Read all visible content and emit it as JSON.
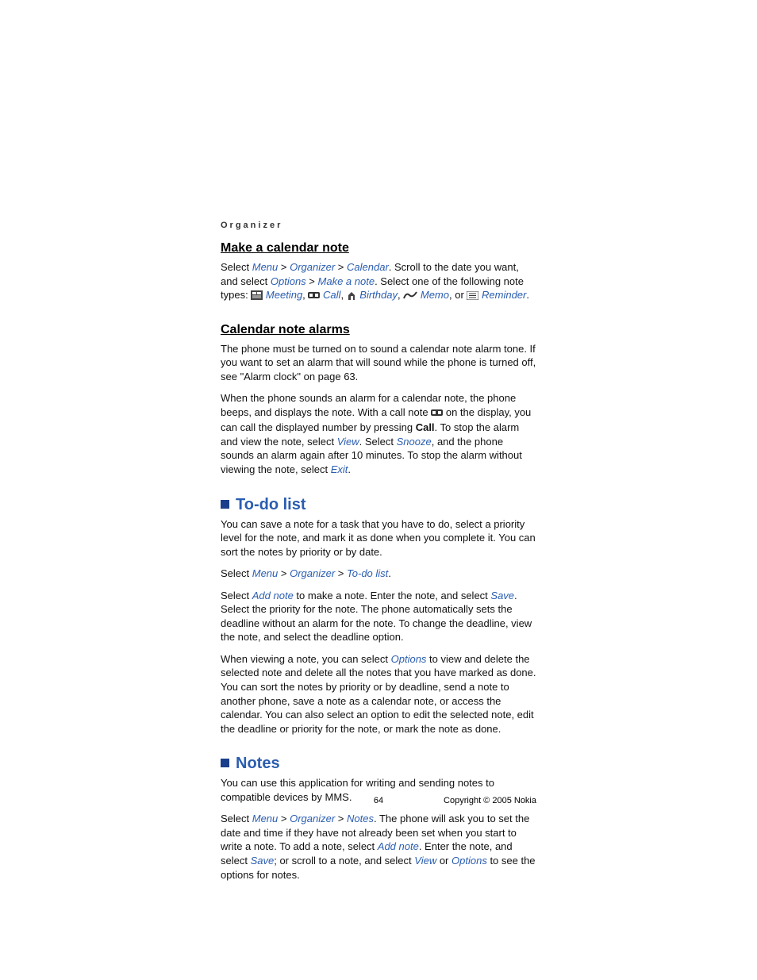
{
  "breadcrumb": "Organizer",
  "sec1": {
    "title": "Make a calendar note",
    "p1_a": "Select ",
    "menu": "Menu",
    "organizer": "Organizer",
    "calendar": "Calendar",
    "p1_b": ". Scroll to the date you want, and select ",
    "options": "Options",
    "makenote": "Make a note",
    "p1_c": ". Select one of the following note types: ",
    "meeting": "Meeting",
    "call": "Call",
    "birthday": "Birthday",
    "memo": "Memo",
    "or": ", or ",
    "reminder": "Reminder",
    "period": "."
  },
  "sec2": {
    "title": "Calendar note alarms",
    "p1": "The phone must be turned on to sound a calendar note alarm tone. If you want to set an alarm that will sound while the phone is turned off, see \"Alarm clock\" on page 63.",
    "p2_a": "When the phone sounds an alarm for a calendar note, the phone beeps, and displays the note. With a call note ",
    "p2_b": " on the display, you can call the displayed number by pressing ",
    "call_key": "Call",
    "p2_c": ". To stop the alarm and view the note, select ",
    "view": "View",
    "p2_d": ". Select ",
    "snooze": "Snooze",
    "p2_e": ", and the phone sounds an alarm again after 10 minutes. To stop the alarm without viewing the note, select ",
    "exit": "Exit",
    "period": "."
  },
  "sec3": {
    "title": "To-do list",
    "p1": "You can save a note for a task that you have to do, select a priority level for the note, and mark it as done when you complete it. You can sort the notes by priority or by date.",
    "p2_a": "Select ",
    "menu": "Menu",
    "organizer": "Organizer",
    "todolist": "To-do list",
    "period": ".",
    "p3_a": "Select ",
    "addnote": "Add note",
    "p3_b": " to make a note. Enter the note, and select ",
    "save": "Save",
    "p3_c": ". Select the priority for the note. The phone automatically sets the deadline without an alarm for the note. To change the deadline, view the note, and select the deadline option.",
    "p4_a": "When viewing a note, you can select ",
    "options": "Options",
    "p4_b": " to view and delete the selected note and delete all the notes that you have marked as done. You can sort the notes by priority or by deadline, send a note to another phone, save a note as a calendar note, or access the calendar. You can also select an option to edit the selected note, edit the deadline or priority for the note, or mark the note as done."
  },
  "sec4": {
    "title": "Notes",
    "p1": "You can use this application for writing and sending notes to compatible devices by MMS.",
    "p2_a": "Select ",
    "menu": "Menu",
    "organizer": "Organizer",
    "notes": "Notes",
    "p2_b": ". The phone will ask you to set the date and time if they have not already been set when you start to write a note. To add a note, select ",
    "addnote": "Add note",
    "p2_c": ". Enter the note, and select ",
    "save": "Save",
    "p2_d": "; or scroll to a note, and select ",
    "view": "View",
    "p2_e": " or ",
    "options": "Options",
    "p2_f": " to see the options for notes."
  },
  "footer": {
    "page": "64",
    "copyright": "Copyright © 2005 Nokia"
  },
  "gt": " > ",
  "comma": ", "
}
